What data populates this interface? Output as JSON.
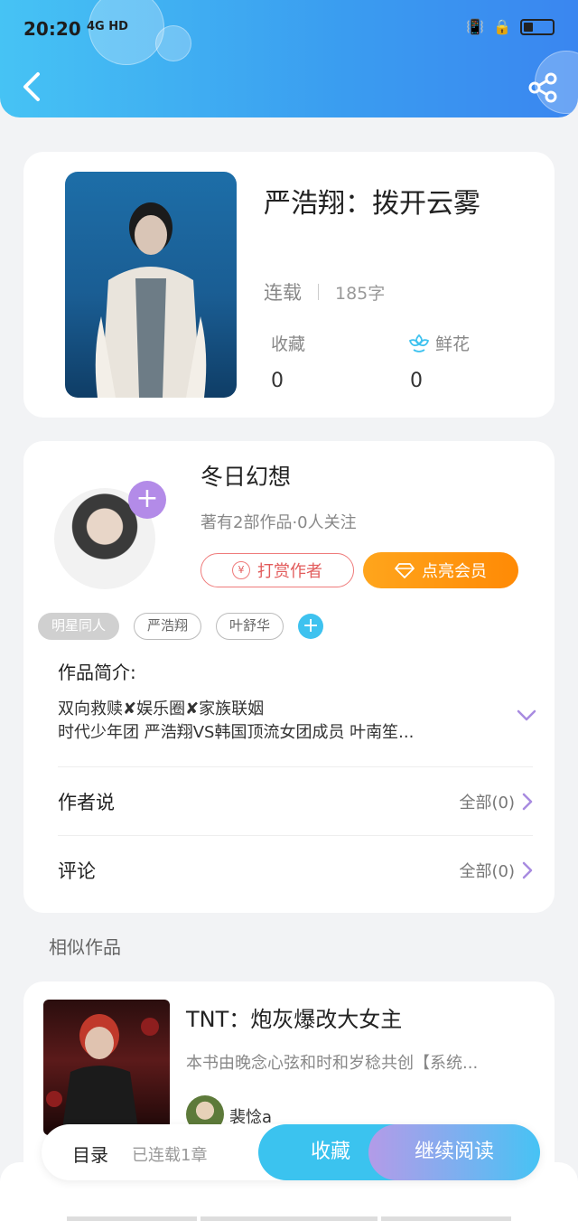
{
  "status_bar": {
    "time": "20:20",
    "network": "4G HD"
  },
  "book": {
    "title": "严浩翔：拨开云雾",
    "status": "连载",
    "word_count": "185字",
    "favorites_label": "收藏",
    "favorites_count": "0",
    "flowers_label": "鲜花",
    "flowers_count": "0"
  },
  "author": {
    "name": "冬日幻想",
    "info": "著有2部作品·0人关注",
    "reward_label": "打赏作者",
    "vip_label": "点亮会员",
    "tags": [
      "明星同人",
      "严浩翔",
      "叶舒华"
    ],
    "intro_label": "作品简介:",
    "intro_line1": "双向救赎✘娱乐圈✘家族联姻",
    "intro_line2": "时代少年团 严浩翔VS韩国顶流女团成员 叶南笙..."
  },
  "rows": {
    "author_says": "作者说",
    "author_says_right": "全部(0)",
    "comments": "评论",
    "comments_right": "全部(0)"
  },
  "similar": {
    "section_title": "相似作品",
    "title": "TNT：炮灰爆改大女主",
    "desc": "本书由晚念心弦和时和岁稔共创【系统...",
    "author": "裴惗a"
  },
  "bottom_bar": {
    "toc": "目录",
    "chapters": "已连载1章",
    "favorite": "收藏",
    "continue": "继续阅读"
  },
  "colors": {
    "accent_blue": "#3bc3ef",
    "purple": "#b38be8",
    "orange": "#ff8a05",
    "red": "#e25b5b"
  }
}
